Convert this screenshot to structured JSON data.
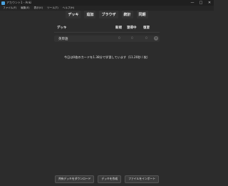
{
  "window": {
    "title": "アカウント1 - Anki",
    "controls": [
      "—",
      "□",
      "✕"
    ]
  },
  "menu": [
    "ファイル(F)",
    "編集(E)",
    "表示(V)",
    "ツール(T)",
    "ヘルプ(H)"
  ],
  "toolbar": [
    "デッキ",
    "追加",
    "ブラウザ",
    "統計",
    "同期"
  ],
  "deck_list": {
    "headers": {
      "deck": "デッキ",
      "new": "新規",
      "learning": "習得中",
      "due": "復習"
    },
    "rows": [
      {
        "name": "英単語",
        "new": "0",
        "learning": "0",
        "due": "0"
      }
    ]
  },
  "stats_text": "今日は0枚のカードを1.38分で学習しています（11.20秒 / 枚）",
  "bottom": {
    "shared": "共有デッキをダウンロード",
    "create": "デッキを作成",
    "import": "ファイルをインポート"
  }
}
